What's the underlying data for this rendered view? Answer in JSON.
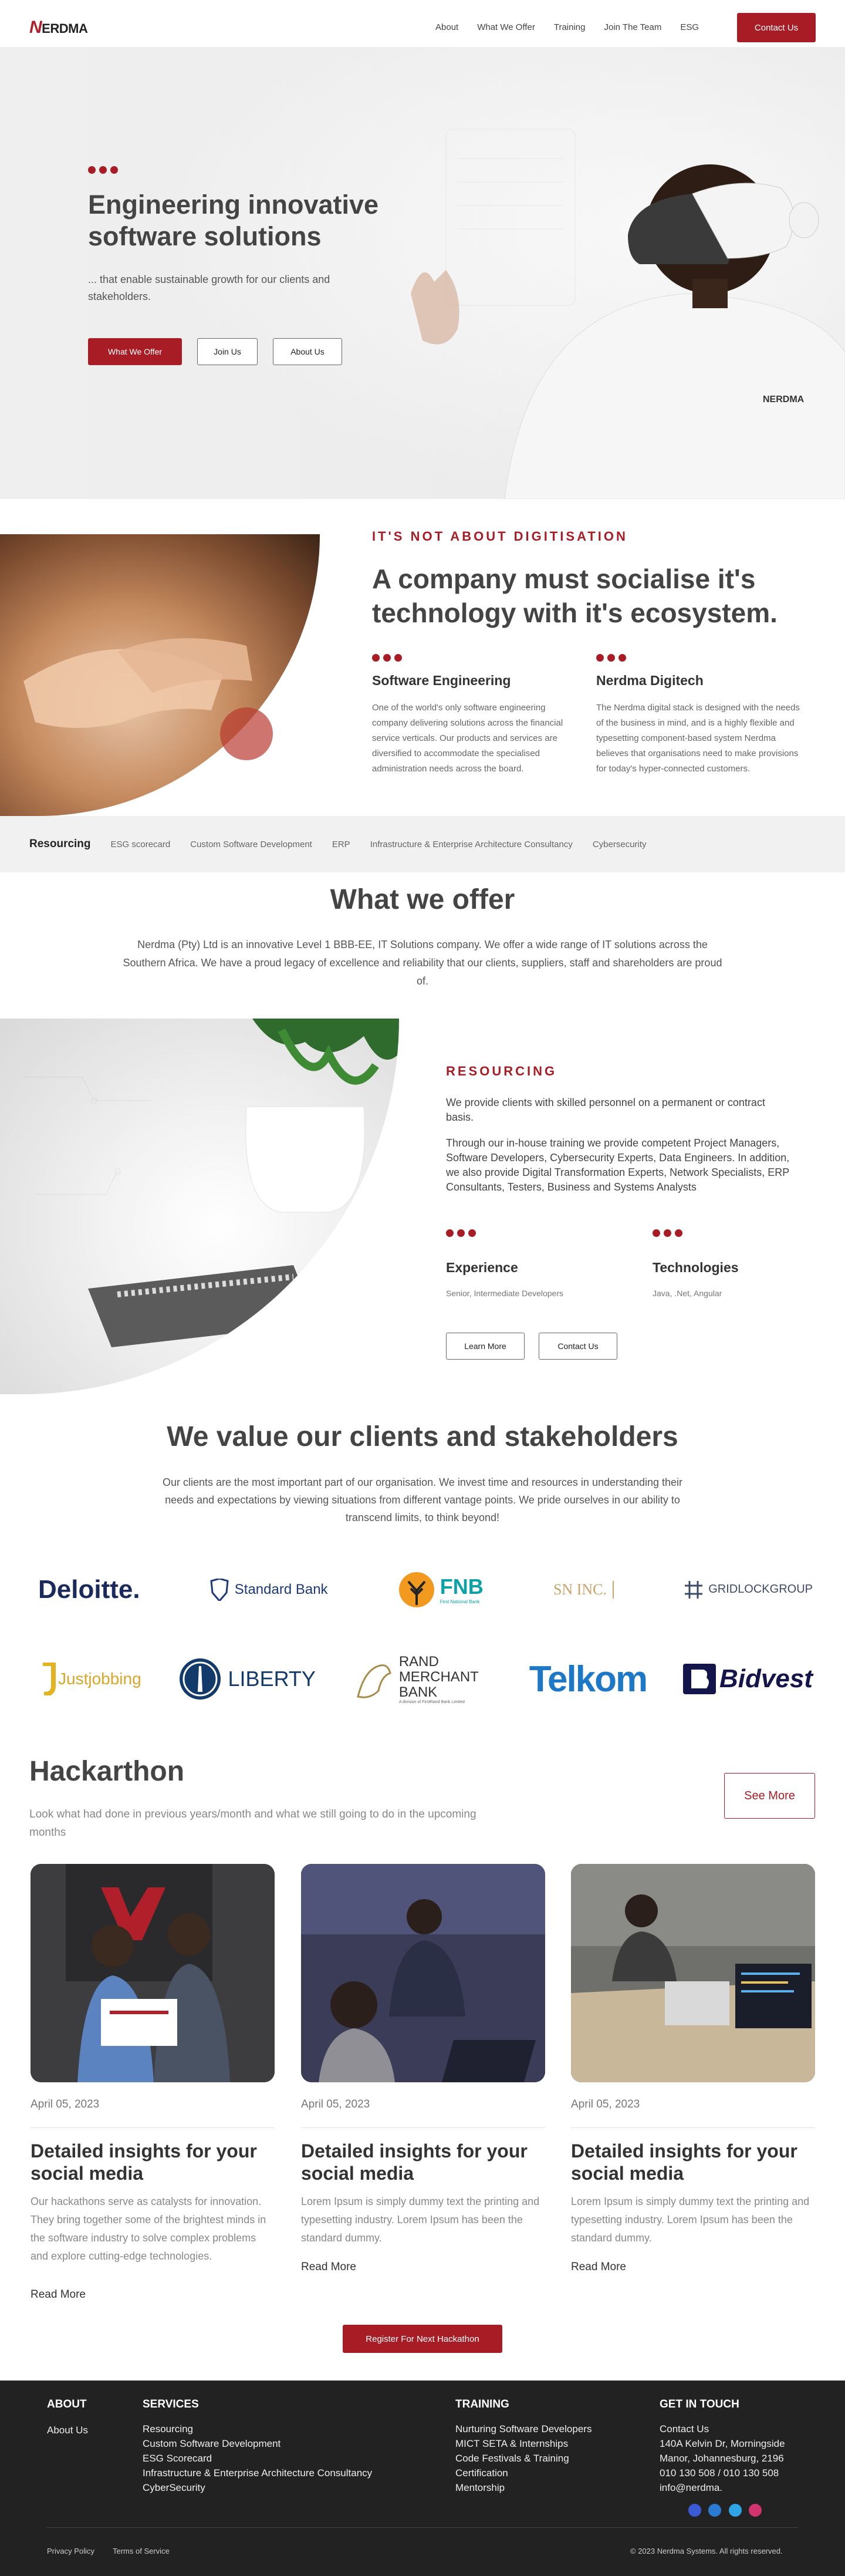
{
  "header": {
    "logo": "NERDMA",
    "logo_prefix": "N",
    "logo_rest": "ERDMA",
    "nav": [
      "About",
      "What We Offer",
      "Training",
      "Join The Team",
      "ESG"
    ],
    "cta": "Contact Us"
  },
  "hero": {
    "title": "Engineering innovative software solutions",
    "subtitle": "... that enable sustainable growth for our clients and stakeholders.",
    "buttons": [
      "What We Offer",
      "Join Us",
      "About Us"
    ],
    "shirt_logo": "NERDMA"
  },
  "about": {
    "kicker": "IT'S NOT ABOUT DIGITISATION",
    "title": "A company must socialise it's technology with it's ecosystem.",
    "cols": [
      {
        "title": "Software Engineering",
        "text": "One of the world's only software engineering company delivering solutions across the financial service verticals. Our products and services are diversified to accommodate the specialised administration needs across the board."
      },
      {
        "title": "Nerdma Digitech",
        "text": "The Nerdma digital stack is designed with the needs of the business in mind, and is a highly flexible and typesetting component-based system Nerdma believes that organisations need to make provisions for today's hyper-connected customers."
      }
    ]
  },
  "tabs": [
    "Resourcing",
    "ESG scorecard",
    "Custom Software Development",
    "ERP",
    "Infrastructure & Enterprise Architecture Consultancy",
    "Cybersecurity"
  ],
  "offer": {
    "title": "What we offer",
    "text": "Nerdma (Pty) Ltd is an innovative Level 1 BBB-EE, IT Solutions company. We offer a wide range of IT solutions across the Southern Africa. We have a proud legacy of excellence and reliability that our clients, suppliers, staff and shareholders are proud of."
  },
  "resourcing": {
    "kicker": "RESOURCING",
    "p1": "We provide clients with skilled personnel on a permanent or contract basis.",
    "p2": "Through our in-house training we provide competent Project Managers, Software Developers, Cybersecurity Experts, Data Engineers. In addition, we also provide Digital Transformation Experts, Network Specialists, ERP Consultants, Testers, Business and Systems Analysts",
    "cols": [
      {
        "title": "Experience",
        "text": "Senior, Intermediate Developers"
      },
      {
        "title": "Technologies",
        "text": "Java, .Net, Angular"
      }
    ],
    "buttons": [
      "Learn More",
      "Contact Us"
    ]
  },
  "clients": {
    "title": "We value our clients and stakeholders",
    "text": "Our clients are the most important part of our organisation. We invest time and resources in understanding their needs and expectations by viewing situations from different vantage points. We pride ourselves in our ability to transcend limits, to think beyond!",
    "logos_row1": [
      "Deloitte.",
      "Standard Bank",
      "FNB",
      "SN INC.",
      "GRIDLOCKGROUP"
    ],
    "logos_row2": [
      "Justjobbing",
      "LIBERTY",
      "RAND MERCHANT BANK",
      "Telkom",
      "Bidvest"
    ],
    "fnb_tagline": "First National Bank",
    "rmb_tagline": "A division of FirstRand Bank Limited"
  },
  "hackathon": {
    "title": "Hackarthon",
    "subtitle": "Look what had done in previous years/month and what we still going to do in the upcoming months",
    "see_more": "See More",
    "cards": [
      {
        "date": "April 05, 2023",
        "title": "Detailed insights for your social media",
        "text": "Our hackathons serve as catalysts for innovation. They bring together some of the brightest minds in the software industry to solve complex problems and explore cutting-edge technologies.",
        "link": "Read More"
      },
      {
        "date": "April 05, 2023",
        "title": "Detailed insights for your social media",
        "text": "Lorem Ipsum is simply dummy text the printing and typesetting industry. Lorem Ipsum has been the standard dummy.",
        "link": "Read More"
      },
      {
        "date": "April 05, 2023",
        "title": "Detailed insights for your social media",
        "text": "Lorem Ipsum is simply dummy text the printing and typesetting industry. Lorem Ipsum has been the standard dummy.",
        "link": "Read More"
      }
    ],
    "register": "Register For Next Hackathon"
  },
  "footer": {
    "about": {
      "title": "ABOUT",
      "links": [
        "About Us"
      ]
    },
    "services": {
      "title": "SERVICES",
      "links": [
        "Resourcing",
        "Custom Software Development",
        "ESG Scorecard",
        "Infrastructure & Enterprise Architecture Consultancy",
        "CyberSecurity"
      ]
    },
    "training": {
      "title": "TRAINING",
      "links": [
        "Nurturing Software Developers",
        "MICT SETA & Internships",
        "Code Festivals & Training",
        "Certification",
        "Mentorship"
      ]
    },
    "contact": {
      "title": "GET IN TOUCH",
      "lines": [
        "Contact Us",
        "140A Kelvin Dr, Morningside",
        "Manor, Johannesburg, 2196",
        "010 130 508 / 010 130 508",
        "info@nerdma."
      ]
    },
    "social": [
      "facebook-icon",
      "linkedin-icon",
      "twitter-icon",
      "instagram-icon"
    ],
    "privacy": "Privacy Policy",
    "terms": "Terms of Service",
    "copyright": "© 2023 Nerdma Systems. All rights reserved."
  },
  "colors": {
    "brand_red": "#a81d25",
    "footer_bg": "#222222"
  }
}
